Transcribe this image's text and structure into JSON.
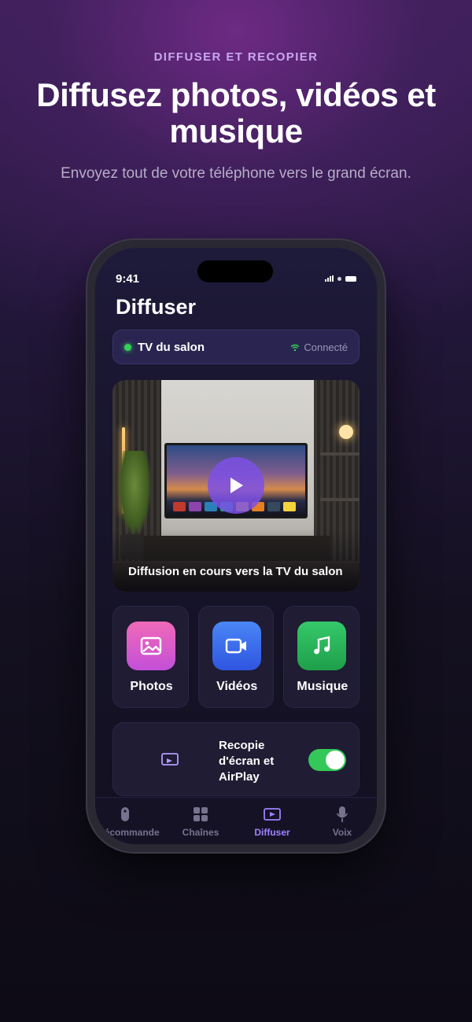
{
  "hero": {
    "eyebrow": "DIFFUSER ET RECOPIER",
    "headline": "Diffusez photos, vidéos et musique",
    "subline": "Envoyez tout de votre téléphone vers le grand écran."
  },
  "status_bar": {
    "time": "9:41"
  },
  "screen": {
    "title": "Diffuser",
    "device": {
      "name": "TV du salon",
      "status": "Connecté",
      "status_icon": "wifi-icon"
    },
    "preview": {
      "caption": "Diffusion en cours vers la TV du salon",
      "icon": "play-icon"
    },
    "media": [
      {
        "label": "Photos",
        "icon": "image-icon",
        "color": "#e05fc0"
      },
      {
        "label": "Vidéos",
        "icon": "video-camera-icon",
        "color": "#3f6ff0"
      },
      {
        "label": "Musique",
        "icon": "music-note-icon",
        "color": "#2bb857"
      }
    ],
    "mirroring": {
      "label": "Recopie d'écran et AirPlay",
      "icon": "screen-mirror-icon",
      "enabled": true
    }
  },
  "tabbar": {
    "active": "Diffuser",
    "items": [
      {
        "label": "Télécommande",
        "icon": "remote-icon"
      },
      {
        "label": "Chaînes",
        "icon": "grid-icon"
      },
      {
        "label": "Diffuser",
        "icon": "cast-icon"
      },
      {
        "label": "Voix",
        "icon": "microphone-icon"
      }
    ]
  },
  "colors": {
    "accent": "#9d82ff",
    "connected": "#34d058",
    "toggle_on": "#34c759"
  }
}
